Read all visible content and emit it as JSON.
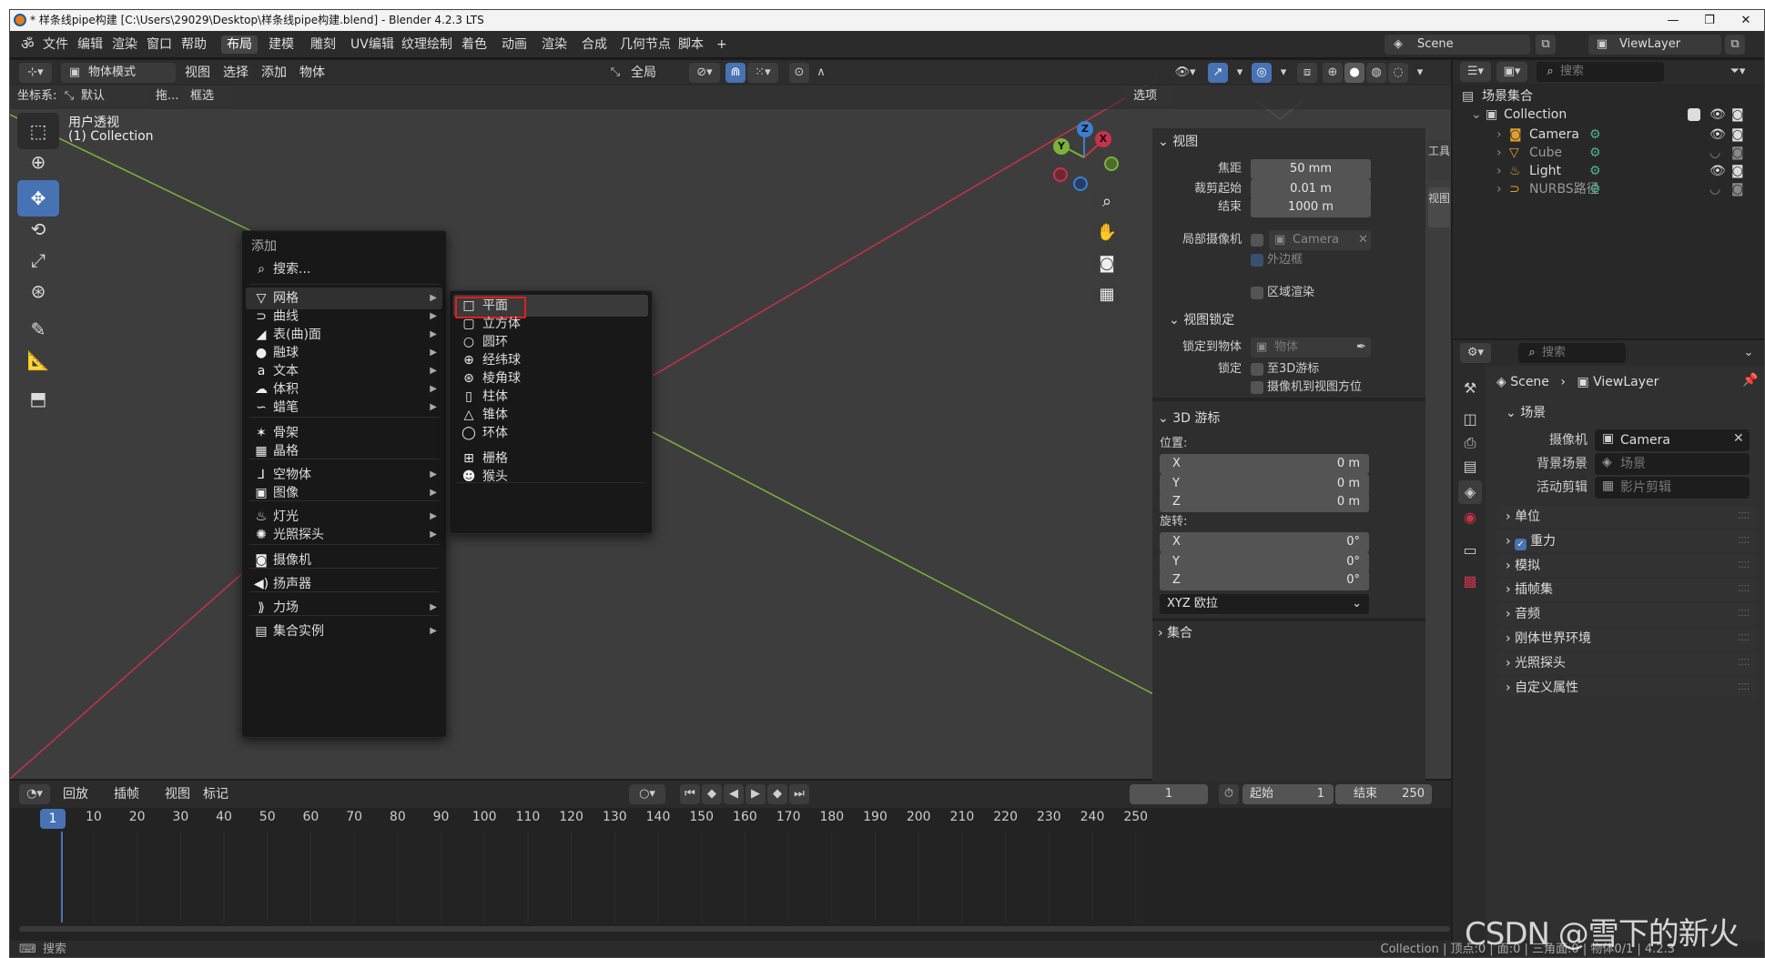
{
  "window": {
    "title": "* 样条线pipe构建 [C:\\Users\\29029\\Desktop\\样条线pipe构建.blend] - Blender 4.2.3 LTS",
    "min": "—",
    "max": "❐",
    "close": "✕"
  },
  "menubar": {
    "items": [
      "文件",
      "编辑",
      "渲染",
      "窗口",
      "帮助"
    ],
    "workspaces": [
      "布局",
      "建模",
      "雕刻",
      "UV编辑",
      "纹理绘制",
      "着色",
      "动画",
      "渲染",
      "合成",
      "几何节点",
      "脚本"
    ],
    "add_workspace": "+",
    "scene": "Scene",
    "view_layer": "ViewLayer"
  },
  "viewport_header": {
    "mode": "物体模式",
    "menus": [
      "视图",
      "选择",
      "添加",
      "物体"
    ],
    "transform": "全局",
    "coord_label": "坐标系:",
    "coord_value": "默认",
    "drag_label": "拖...",
    "select_mode": "框选",
    "options": "选项"
  },
  "viewport_overlay": {
    "view_name": "用户透视",
    "collection": "(1) Collection"
  },
  "gizmo": {
    "x": "X",
    "y": "Y",
    "z": "Z"
  },
  "side_tabs": [
    "工具",
    "视图"
  ],
  "npanel": {
    "view": {
      "title": "视图",
      "focal_label": "焦距",
      "focal": "50 mm",
      "clip_start_label": "裁剪起始",
      "clip_start": "0.01 m",
      "clip_end_label": "结束",
      "clip_end": "1000 m",
      "local_camera_label": "局部摄像机",
      "local_camera": "Camera",
      "border_label": "外边框",
      "region_render_label": "区域渲染"
    },
    "view_lock": {
      "title": "视图锁定",
      "lock_object_label": "锁定到物体",
      "lock_object_placeholder": "物体",
      "lock_label": "锁定",
      "to_cursor": "至3D游标",
      "camera_to_view": "摄像机到视图方位"
    },
    "cursor": {
      "title": "3D 游标",
      "location_label": "位置:",
      "loc": [
        {
          "axis": "X",
          "value": "0 m"
        },
        {
          "axis": "Y",
          "value": "0 m"
        },
        {
          "axis": "Z",
          "value": "0 m"
        }
      ],
      "rotation_label": "旋转:",
      "rot": [
        {
          "axis": "X",
          "value": "0°"
        },
        {
          "axis": "Y",
          "value": "0°"
        },
        {
          "axis": "Z",
          "value": "0°"
        }
      ],
      "rot_mode": "XYZ 欧拉"
    },
    "collection_title": "集合"
  },
  "add_menu": {
    "title": "添加",
    "search": "搜索...",
    "items": [
      {
        "label": "网格",
        "icon": "▽",
        "sub": true
      },
      {
        "label": "曲线",
        "icon": "⊃",
        "sub": true
      },
      {
        "label": "表(曲)面",
        "icon": "◢",
        "sub": true
      },
      {
        "label": "融球",
        "icon": "●",
        "sub": true
      },
      {
        "label": "文本",
        "icon": "a",
        "sub": true
      },
      {
        "label": "体积",
        "icon": "☁",
        "sub": true
      },
      {
        "label": "蜡笔",
        "icon": "∽",
        "sub": true
      },
      {
        "label": "骨架",
        "icon": "✶",
        "sub": false
      },
      {
        "label": "晶格",
        "icon": "▦",
        "sub": false
      },
      {
        "label": "空物体",
        "icon": "⅃",
        "sub": true
      },
      {
        "label": "图像",
        "icon": "▣",
        "sub": true
      },
      {
        "label": "灯光",
        "icon": "♨",
        "sub": true
      },
      {
        "label": "光照探头",
        "icon": "✺",
        "sub": true
      },
      {
        "label": "摄像机",
        "icon": "◙",
        "sub": false
      },
      {
        "label": "扬声器",
        "icon": "◀)",
        "sub": false
      },
      {
        "label": "力场",
        "icon": "⟫",
        "sub": true
      },
      {
        "label": "集合实例",
        "icon": "▤",
        "sub": true
      }
    ]
  },
  "mesh_menu": {
    "items": [
      {
        "label": "平面",
        "icon": "□"
      },
      {
        "label": "立方体",
        "icon": "▢"
      },
      {
        "label": "圆环",
        "icon": "○"
      },
      {
        "label": "经纬球",
        "icon": "⊕"
      },
      {
        "label": "棱角球",
        "icon": "⊛"
      },
      {
        "label": "柱体",
        "icon": "▯"
      },
      {
        "label": "锥体",
        "icon": "△"
      },
      {
        "label": "环体",
        "icon": "◯"
      },
      {
        "label": "栅格",
        "icon": "⊞"
      },
      {
        "label": "猴头",
        "icon": "☻"
      }
    ]
  },
  "outliner": {
    "search_placeholder": "搜索",
    "root": "场景集合",
    "collection": "Collection",
    "objects": [
      {
        "name": "Camera",
        "icon": "◙",
        "color": "#e0a030"
      },
      {
        "name": "Cube",
        "icon": "▽",
        "color": "#e0a030"
      },
      {
        "name": "Light",
        "icon": "♨",
        "color": "#e0a030"
      },
      {
        "name": "NURBS路径",
        "icon": "⊃",
        "color": "#e0a030"
      }
    ]
  },
  "properties": {
    "search_placeholder": "搜索",
    "breadcrumb_scene": "Scene",
    "breadcrumb_layer": "ViewLayer",
    "scene_title": "场景",
    "camera_label": "摄像机",
    "camera": "Camera",
    "bg_label": "背景场景",
    "bg_placeholder": "场景",
    "clip_label": "活动剪辑",
    "clip_placeholder": "影片剪辑",
    "sections": [
      "单位",
      "重力",
      "模拟",
      "插帧集",
      "音频",
      "刚体世界环境",
      "光照探头",
      "自定义属性"
    ]
  },
  "timeline": {
    "menus": [
      "回放",
      "插帧",
      "视图",
      "标记"
    ],
    "current_frame": "1",
    "start_label": "起始",
    "start": "1",
    "end_label": "结束",
    "end": "250",
    "ticks": [
      "1",
      "10",
      "20",
      "30",
      "40",
      "50",
      "60",
      "70",
      "80",
      "90",
      "100",
      "110",
      "120",
      "130",
      "140",
      "150",
      "160",
      "170",
      "180",
      "190",
      "200",
      "210",
      "220",
      "230",
      "240",
      "250"
    ]
  },
  "statusbar": {
    "search": "搜索",
    "info": "Collection | 顶点:0 | 面:0 | 三角面:0 | 物体0/1 | 4.2.3"
  },
  "watermark": "CSDN @雪下的新火",
  "colors": {
    "accent": "#4772b3",
    "highlight": "#e01f1f",
    "x_axis": "#c8324a",
    "y_axis": "#7ab33a"
  }
}
